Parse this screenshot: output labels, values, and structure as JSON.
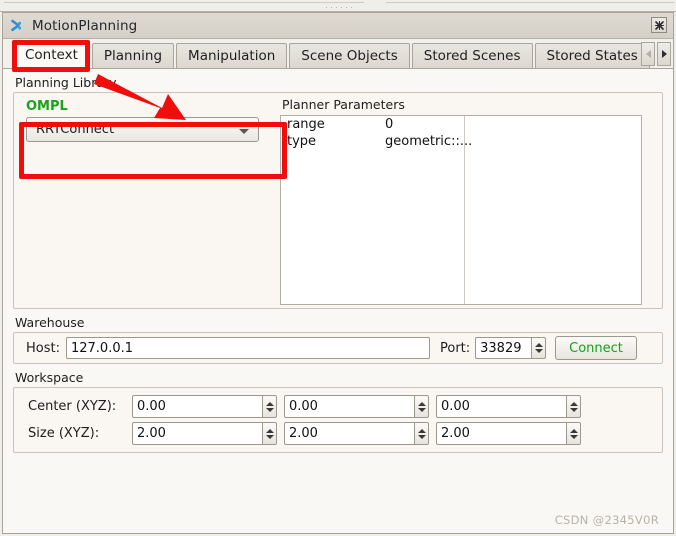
{
  "window": {
    "title": "MotionPlanning",
    "icon": "panel-chevron-icon",
    "close_label": "✖"
  },
  "tabs": {
    "items": [
      {
        "label": "Context",
        "active": true
      },
      {
        "label": "Planning",
        "active": false
      },
      {
        "label": "Manipulation",
        "active": false
      },
      {
        "label": "Scene Objects",
        "active": false
      },
      {
        "label": "Stored Scenes",
        "active": false
      },
      {
        "label": "Stored States",
        "active": false
      }
    ],
    "scroll_left": "◀",
    "scroll_right": "▶"
  },
  "planning_library": {
    "title": "Planning Library",
    "ompl_label": "OMPL",
    "ompl_color": "#19a319",
    "planner_selected": "RRTConnect",
    "params_title": "Planner Parameters",
    "params": [
      {
        "key": "range",
        "value": "0"
      },
      {
        "key": "type",
        "value": "geometric::..."
      }
    ]
  },
  "warehouse": {
    "title": "Warehouse",
    "host_label": "Host:",
    "host_value": "127.0.0.1",
    "port_label": "Port:",
    "port_value": "33829",
    "connect_label": "Connect",
    "connect_color": "#14a019"
  },
  "workspace": {
    "title": "Workspace",
    "rows": [
      {
        "label": "Center (XYZ):",
        "x": "0.00",
        "y": "0.00",
        "z": "0.00"
      },
      {
        "label": "Size (XYZ):",
        "x": "2.00",
        "y": "2.00",
        "z": "2.00"
      }
    ]
  },
  "annotations": {
    "highlight_color": "#f20d0d",
    "arrow": "red-arrow-pointing-to-planner-dropdown"
  },
  "watermark": {
    "text": "CSDN @2345V0R"
  }
}
